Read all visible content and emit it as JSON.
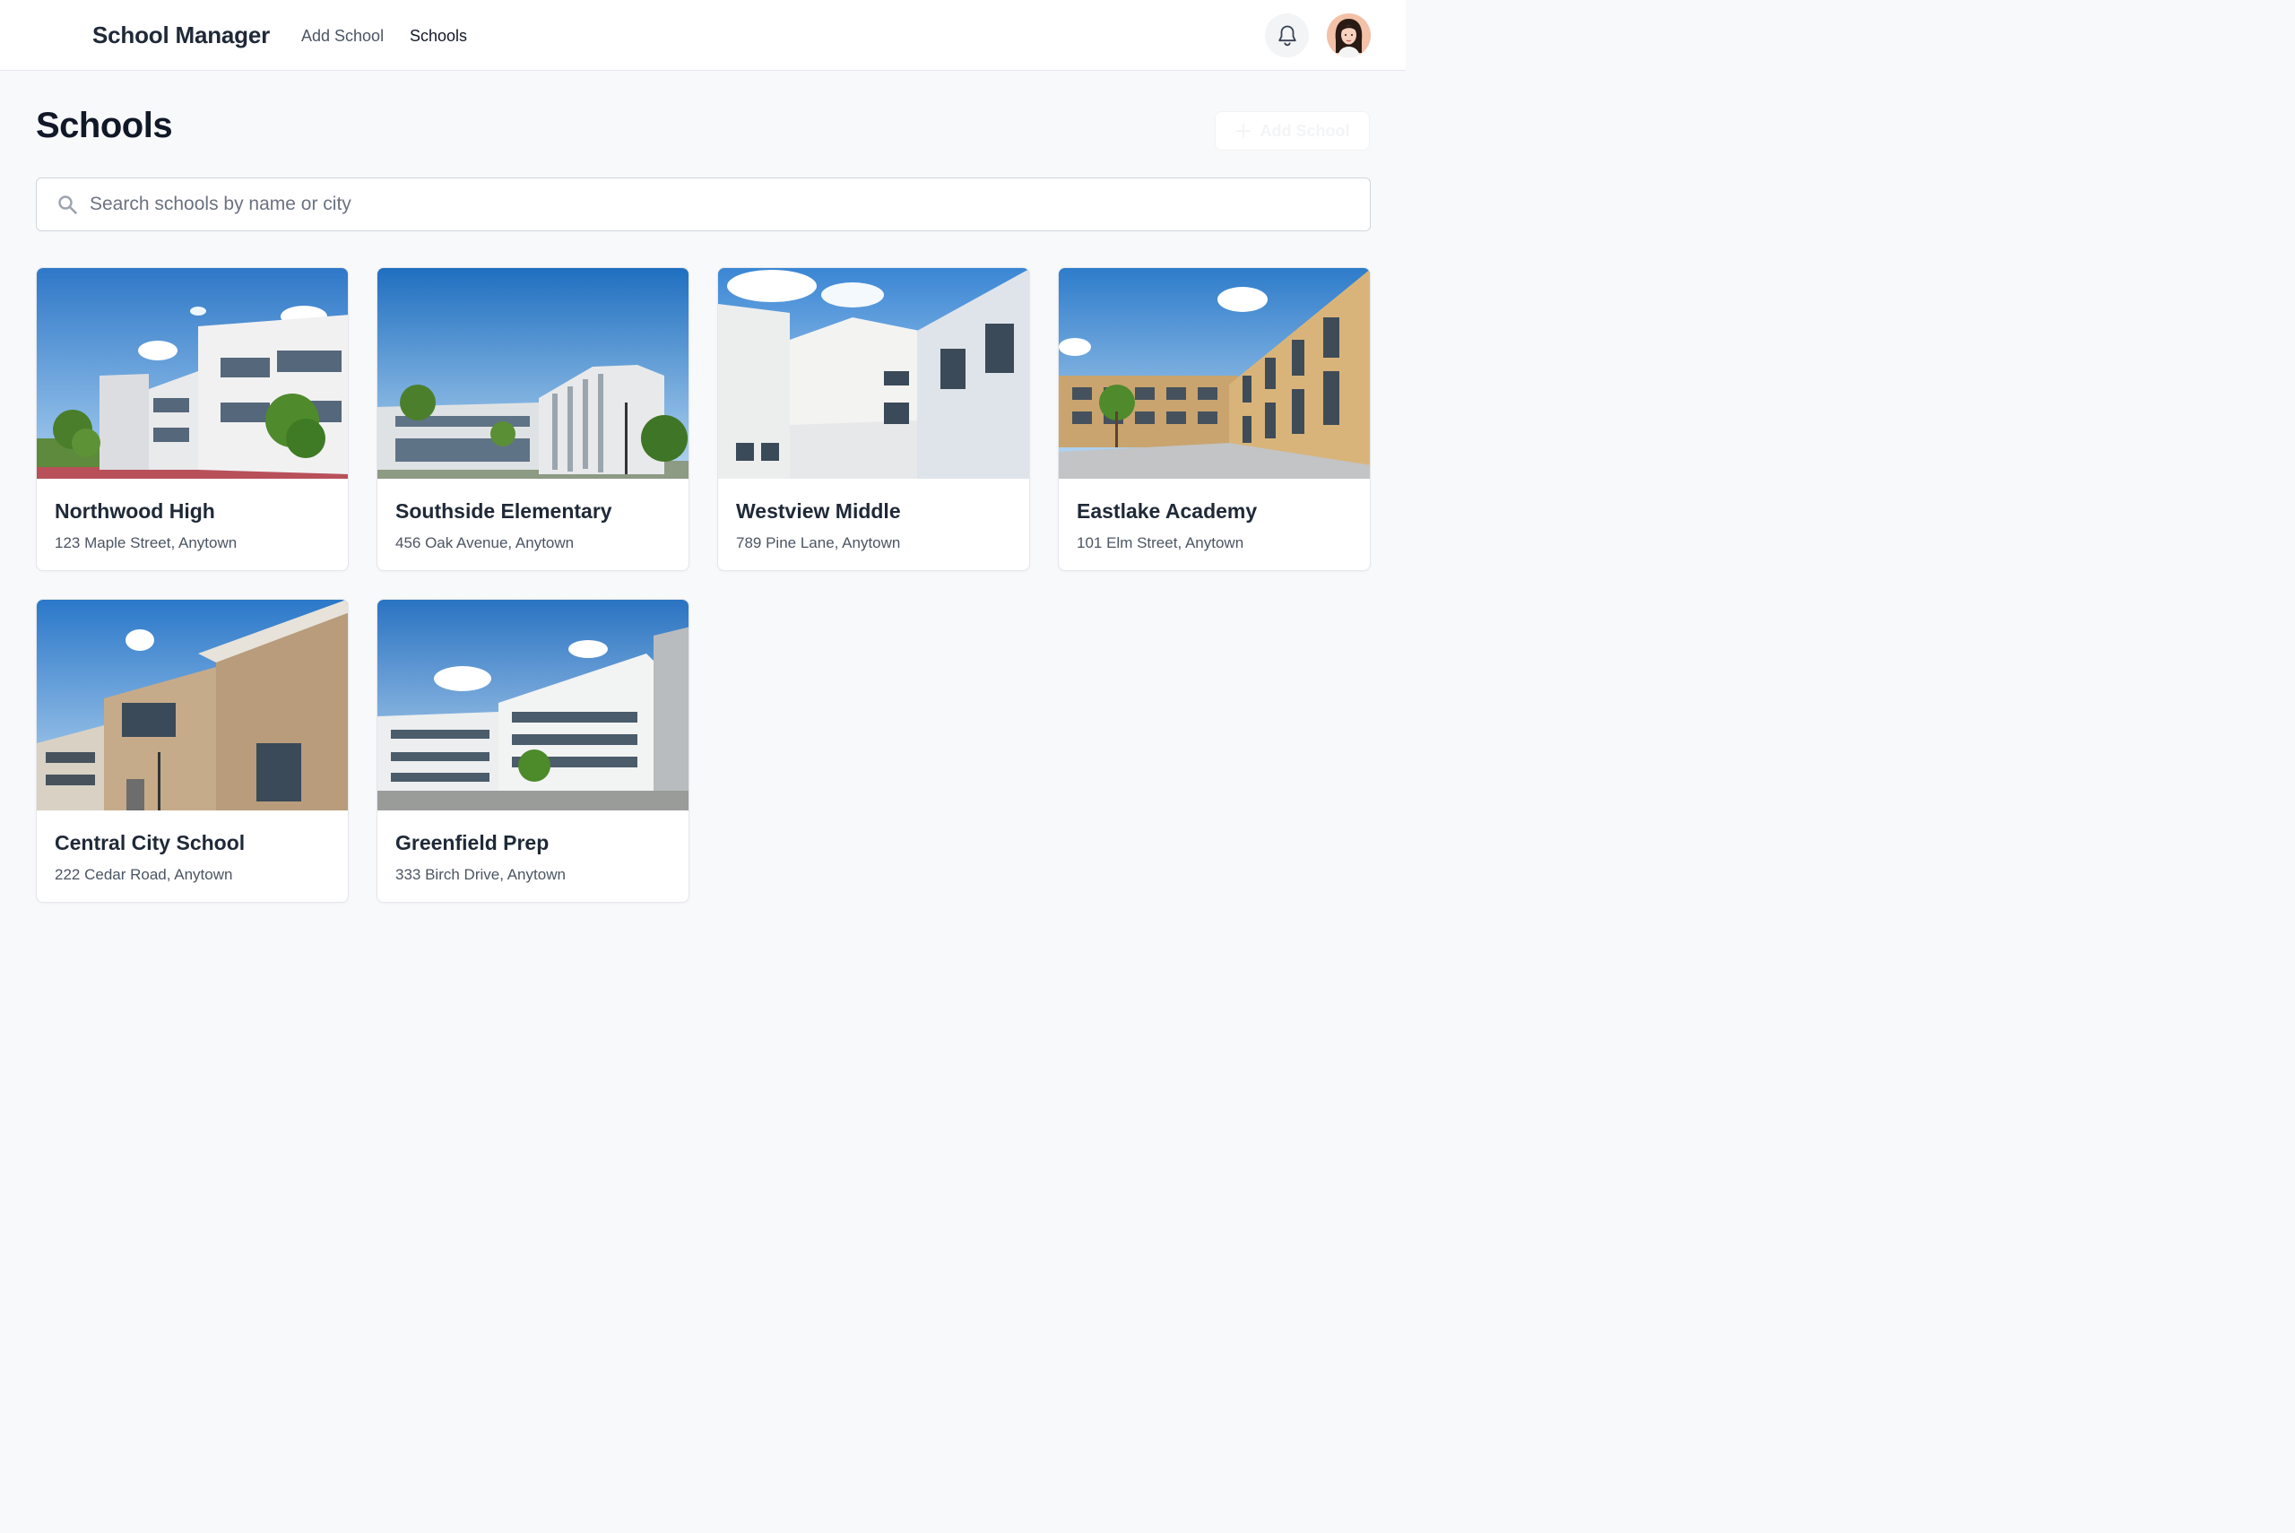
{
  "header": {
    "brand": "School Manager",
    "nav": [
      {
        "label": "Add School"
      },
      {
        "label": "Schools",
        "active": true
      }
    ],
    "icons": [
      "bell-icon",
      "user-avatar"
    ]
  },
  "page": {
    "title": "Schools",
    "add_button_label": "Add School",
    "search_placeholder": "Search schools by name or city"
  },
  "schools": [
    {
      "name": "Northwood High",
      "address": "123 Maple Street, Anytown"
    },
    {
      "name": "Southside Elementary",
      "address": "456 Oak Avenue, Anytown"
    },
    {
      "name": "Westview Middle",
      "address": "789 Pine Lane, Anytown"
    },
    {
      "name": "Eastlake Academy",
      "address": "101 Elm Street, Anytown"
    },
    {
      "name": "Central City School",
      "address": "222 Cedar Road, Anytown"
    },
    {
      "name": "Greenfield Prep",
      "address": "333 Birch Drive, Anytown"
    }
  ],
  "colors": {
    "background": "#f8f9fb",
    "text_primary": "#111827",
    "text_secondary": "#4b5563",
    "border": "#e5e7eb"
  }
}
